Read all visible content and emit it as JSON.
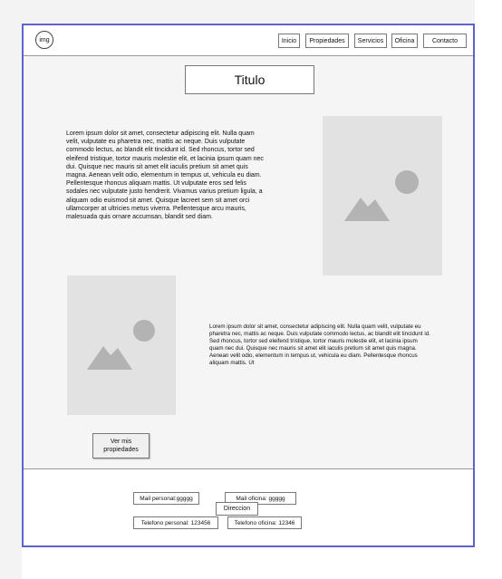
{
  "header": {
    "logo_label": "img",
    "nav": [
      {
        "label": "Inicio"
      },
      {
        "label": "Propiedades"
      },
      {
        "label": "Servicios"
      },
      {
        "label": "Oficina"
      },
      {
        "label": "Contacto"
      }
    ]
  },
  "main": {
    "title": "Titulo",
    "paragraph_1": "Lorem ipsum dolor sit amet, consectetur adipiscing elit. Nulla quam velit, vulputate eu pharetra nec, mattis ac neque. Duis vulputate commodo lectus, ac blandit elit tincidunt id. Sed rhoncus, tortor sed eleifend tristique, tortor mauris molestie elit, et lacinia ipsum quam nec dui. Quisque nec mauris sit amet elit iaculis pretium sit amet quis magna. Aenean velit odio, elementum in tempus ut, vehicula eu diam. Pellentesque rhoncus aliquam mattis. Ut vulputate eros sed felis sodales nec vulputate justo hendrerit. Vivamus varius pretium ligula, a aliquam odio euismod sit amet. Quisque lacreet sem sit amet orci ullamcorper at ultricies metus viverra. Pellentesque arcu mauris, malesuada quis ornare accumsan, blandit sed diam.",
    "paragraph_2": "Lorem ipsum dolor sit amet, consectetur adipiscing elit. Nulla quam velit, vulputate eu pharetra nec, mattis ac neque. Duis vulputate commodo lectus, ac blandit elit tincidunt id. Sed rhoncus, tortor sed eleifend tristique, tortor mauris molestie elit, et lacinia ipsum quam nec dui. Quisque nec mauris sit amet elit iaculis pretium sit amet quis magna. Aenean velit odio, elementum in tempus ut, vehicula eu diam. Pellentesque rhoncus aliquam mattis. Ut",
    "ver_button": "Ver mis propiedades"
  },
  "footer": {
    "mail_personal": "Mail personal:ggggg",
    "mail_oficina": "Mail oficina: ggggg",
    "telefono_personal": "Telefono personal: 123456",
    "telefono_oficina": "Telefono oficina: 12346",
    "direccion": "Direccion"
  },
  "colors": {
    "frame_border": "#5d63c9",
    "placeholder_bg": "#e2e2e2",
    "placeholder_icon": "#b3b3b3"
  },
  "icons": [
    "image-placeholder-icon"
  ]
}
